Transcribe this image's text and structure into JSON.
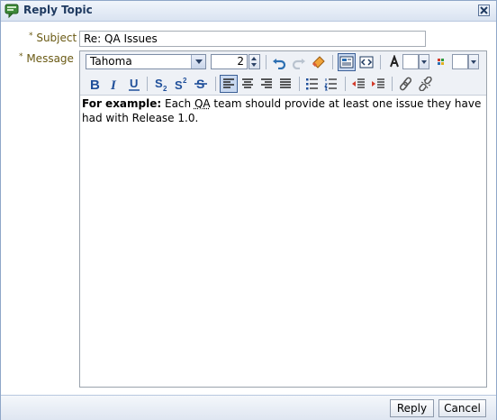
{
  "dialog": {
    "title": "Reply Topic"
  },
  "form": {
    "subject_label": "Subject",
    "message_label": "Message",
    "required_marker": "*",
    "subject_value": "Re: QA Issues"
  },
  "toolbar": {
    "font_family": "Tahoma",
    "font_size": "2",
    "icons": [
      "undo-icon",
      "redo-icon",
      "eraser-icon",
      "rich-text-mode-icon",
      "source-mode-icon",
      "text-color-icon",
      "background-color-icon",
      "bold-icon",
      "italic-icon",
      "underline-icon",
      "subscript-icon",
      "superscript-icon",
      "strikethrough-icon",
      "align-left-icon",
      "align-center-icon",
      "align-right-icon",
      "justify-icon",
      "bulleted-list-icon",
      "numbered-list-icon",
      "outdent-icon",
      "indent-icon",
      "link-icon",
      "unlink-icon"
    ]
  },
  "message": {
    "bold_prefix": "For example:",
    "body_pre": " Each ",
    "body_qa": "QA",
    "body_post": " team should provide at least one issue they have had with Release 1.0."
  },
  "buttons": {
    "reply": "Reply",
    "cancel": "Cancel"
  },
  "colors": {
    "accent": "#1f3a60",
    "label": "#6a5a14"
  }
}
